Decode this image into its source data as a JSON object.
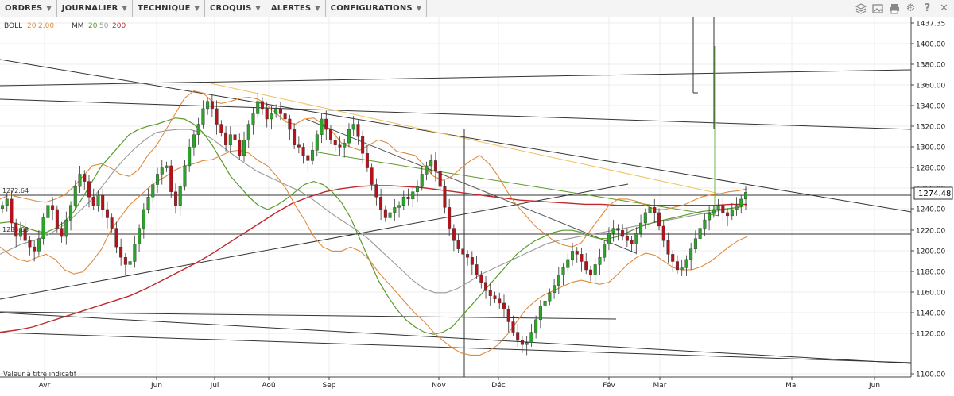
{
  "toolbar": {
    "menus": [
      "ORDRES",
      "JOURNALIER",
      "TECHNIQUE",
      "CROQUIS",
      "ALERTES",
      "CONFIGURATIONS"
    ],
    "icons": [
      "layers-icon",
      "image-icon",
      "print-icon",
      "gear-icon",
      "help-icon",
      "close-icon"
    ]
  },
  "legend": {
    "boll_name": "BOLL",
    "boll_p1": "20",
    "boll_p2": "2.00",
    "mm_name": "MM",
    "mm_p1": "20",
    "mm_p2": "50",
    "mm_p3": "200"
  },
  "footer_note": "Valeur à titre indicatif",
  "left_labels": [
    "1272.64",
    "1233.63"
  ],
  "chart_data": {
    "type": "candlestick",
    "x_ticks": [
      "Avr",
      "Jun",
      "Jul",
      "Aoû",
      "Sep",
      "Nov",
      "Déc",
      "Fév",
      "Mar",
      "Mai",
      "Jun"
    ],
    "y_ticks": [
      "1437.35",
      "1400.00",
      "1380.00",
      "1360.00",
      "1340.00",
      "1320.00",
      "1300.00",
      "1280.00",
      "1260.00",
      "1240.00",
      "1220.00",
      "1200.00",
      "1180.00",
      "1160.00",
      "1140.00",
      "1120.00",
      "1100.00"
    ],
    "last_price": "1274.48",
    "ylim": [
      1100,
      1437.35
    ],
    "colors": {
      "up": "#2aa52a",
      "down": "#b5121b",
      "bollinger": "#e08a3c",
      "mm20": "#5a9a2a",
      "mm50": "#9a9a9a",
      "mm200": "#c0282d",
      "trendline": "#333333",
      "fibo": "#f0c060"
    },
    "closes": [
      1262,
      1268,
      1245,
      1232,
      1240,
      1228,
      1222,
      1218,
      1230,
      1250,
      1262,
      1258,
      1240,
      1232,
      1248,
      1262,
      1280,
      1292,
      1285,
      1270,
      1262,
      1272,
      1258,
      1250,
      1240,
      1222,
      1212,
      1205,
      1208,
      1225,
      1240,
      1258,
      1270,
      1282,
      1292,
      1298,
      1300,
      1275,
      1262,
      1280,
      1300,
      1318,
      1330,
      1340,
      1355,
      1362,
      1355,
      1340,
      1332,
      1320,
      1330,
      1325,
      1310,
      1325,
      1340,
      1350,
      1362,
      1355,
      1345,
      1350,
      1355,
      1350,
      1345,
      1335,
      1320,
      1318,
      1310,
      1305,
      1315,
      1330,
      1345,
      1335,
      1325,
      1320,
      1318,
      1322,
      1335,
      1340,
      1328,
      1312,
      1298,
      1282,
      1270,
      1258,
      1250,
      1255,
      1260,
      1262,
      1270,
      1268,
      1275,
      1280,
      1292,
      1300,
      1305,
      1295,
      1280,
      1260,
      1240,
      1228,
      1220,
      1215,
      1212,
      1205,
      1195,
      1188,
      1180,
      1175,
      1172,
      1168,
      1162,
      1150,
      1140,
      1132,
      1128,
      1130,
      1140,
      1152,
      1165,
      1170,
      1178,
      1185,
      1195,
      1202,
      1210,
      1218,
      1215,
      1208,
      1200,
      1195,
      1205,
      1212,
      1225,
      1235,
      1240,
      1238,
      1232,
      1228,
      1225,
      1235,
      1245,
      1255,
      1260,
      1255,
      1242,
      1228,
      1215,
      1208,
      1200,
      1202,
      1210,
      1220,
      1230,
      1240,
      1248,
      1254,
      1258,
      1262,
      1255,
      1252,
      1258,
      1262,
      1268,
      1274.48
    ],
    "bollinger_upper": [
      1268,
      1272,
      1270,
      1268,
      1266,
      1265,
      1268,
      1272,
      1280,
      1290,
      1300,
      1302,
      1298,
      1292,
      1290,
      1296,
      1310,
      1320,
      1335,
      1350,
      1365,
      1372,
      1370,
      1362,
      1360,
      1362,
      1365,
      1366,
      1364,
      1358,
      1350,
      1342,
      1340,
      1345,
      1346,
      1340,
      1333,
      1322,
      1318,
      1315,
      1320,
      1325,
      1322,
      1314,
      1312,
      1310,
      1300,
      1290,
      1286,
      1290,
      1298,
      1305,
      1310,
      1302,
      1290,
      1275,
      1262,
      1252,
      1242,
      1235,
      1228,
      1224,
      1222,
      1226,
      1238,
      1250,
      1262,
      1268,
      1268,
      1266,
      1262,
      1258,
      1258,
      1260,
      1262,
      1266,
      1270,
      1272,
      1273,
      1275,
      1276,
      1278
    ],
    "bollinger_lower": [
      1222,
      1215,
      1210,
      1208,
      1212,
      1215,
      1210,
      1200,
      1196,
      1198,
      1208,
      1220,
      1238,
      1250,
      1262,
      1270,
      1278,
      1285,
      1290,
      1296,
      1300,
      1302,
      1305,
      1306,
      1310,
      1314,
      1315,
      1312,
      1305,
      1300,
      1290,
      1278,
      1262,
      1248,
      1232,
      1222,
      1218,
      1218,
      1222,
      1218,
      1210,
      1198,
      1188,
      1178,
      1168,
      1158,
      1150,
      1140,
      1132,
      1125,
      1120,
      1118,
      1118,
      1122,
      1128,
      1138,
      1150,
      1162,
      1170,
      1176,
      1180,
      1184,
      1188,
      1190,
      1188,
      1186,
      1188,
      1196,
      1205,
      1212,
      1216,
      1214,
      1208,
      1202,
      1200,
      1200,
      1203,
      1208,
      1215,
      1222,
      1228,
      1232
    ],
    "mm20": [
      1245,
      1246,
      1244,
      1240,
      1237,
      1236,
      1240,
      1246,
      1256,
      1270,
      1285,
      1300,
      1310,
      1320,
      1330,
      1335,
      1338,
      1340,
      1343,
      1346,
      1345,
      1340,
      1332,
      1320,
      1305,
      1290,
      1280,
      1270,
      1262,
      1258,
      1262,
      1268,
      1275,
      1282,
      1285,
      1282,
      1275,
      1265,
      1250,
      1230,
      1210,
      1190,
      1175,
      1162,
      1152,
      1145,
      1140,
      1138,
      1140,
      1145,
      1155,
      1165,
      1175,
      1185,
      1195,
      1205,
      1215,
      1222,
      1228,
      1232,
      1236,
      1238,
      1238,
      1236,
      1232,
      1230,
      1230,
      1232,
      1236,
      1240,
      1243,
      1246,
      1248,
      1250,
      1252,
      1254,
      1256,
      1257,
      1258,
      1259,
      1260,
      1262
    ],
    "mm50": [
      1215,
      1220,
      1225,
      1228,
      1232,
      1238,
      1245,
      1255,
      1265,
      1278,
      1292,
      1305,
      1316,
      1325,
      1332,
      1334,
      1335,
      1335,
      1332,
      1326,
      1318,
      1310,
      1302,
      1295,
      1290,
      1285,
      1280,
      1275,
      1268,
      1260,
      1252,
      1245,
      1238,
      1230,
      1220,
      1210,
      1200,
      1190,
      1182,
      1178,
      1178,
      1182,
      1188,
      1195,
      1200,
      1205,
      1210,
      1215,
      1220,
      1225,
      1228,
      1230,
      1232,
      1234,
      1236,
      1238,
      1240,
      1242,
      1244,
      1246,
      1248,
      1250,
      1252,
      1254,
      1256,
      1258,
      1260,
      1262
    ],
    "mm200": [
      1140,
      1142,
      1145,
      1150,
      1155,
      1160,
      1165,
      1170,
      1175,
      1182,
      1190,
      1198,
      1206,
      1215,
      1225,
      1235,
      1245,
      1255,
      1264,
      1270,
      1275,
      1278,
      1280,
      1281,
      1281,
      1280,
      1279,
      1277,
      1275,
      1273,
      1271,
      1269,
      1267,
      1266,
      1265,
      1264,
      1263,
      1263,
      1262,
      1262,
      1262,
      1262,
      1262,
      1262,
      1262,
      1263,
      1263
    ]
  }
}
